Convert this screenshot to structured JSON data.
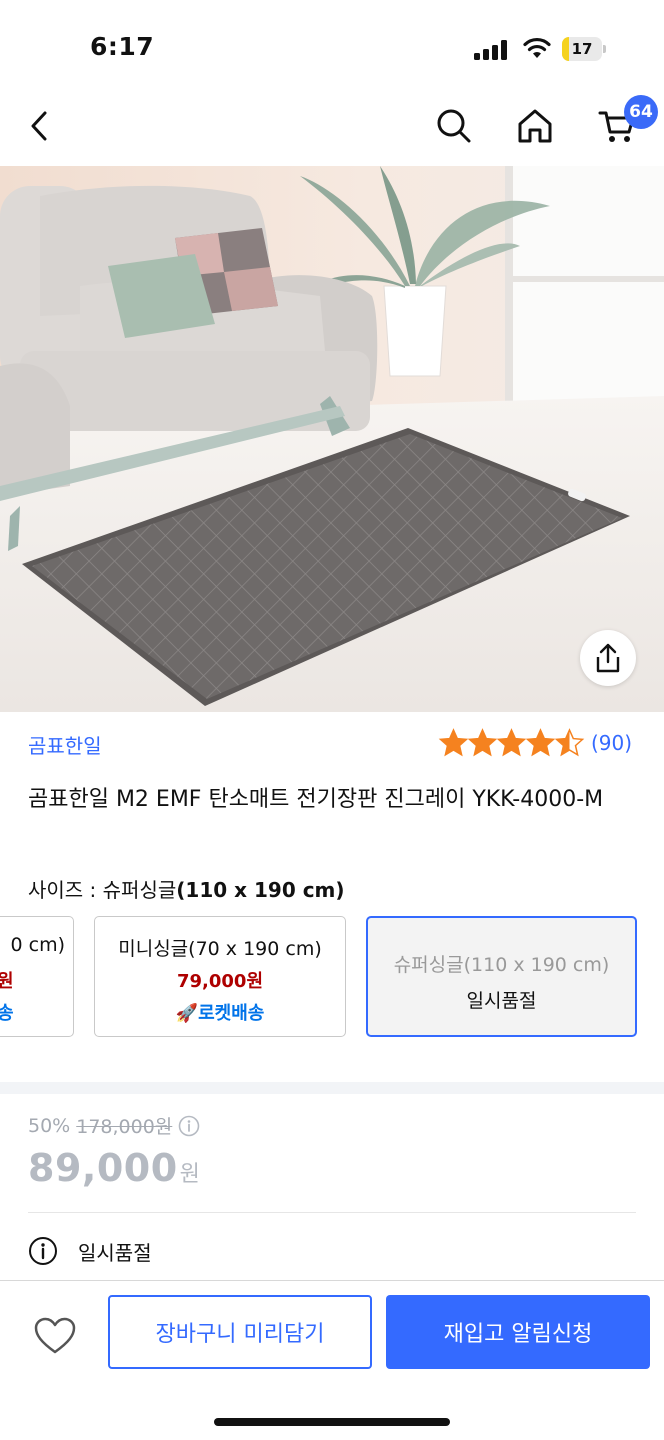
{
  "status_bar": {
    "time": "6:17",
    "battery_level": "17",
    "battery_fraction": 0.17,
    "battery_color": "#f5d21e"
  },
  "nav": {
    "back_icon": "chevron-left-icon",
    "search_icon": "search-icon",
    "home_icon": "home-icon",
    "cart_icon": "cart-icon",
    "cart_count": "64"
  },
  "product": {
    "image_alt": "living room heated mat",
    "brand": "곰표한일",
    "rating": 4.5,
    "review_count": "(90)",
    "title": "곰표한일 M2 EMF 탄소매트 전기장판 진그레이 YKK-4000-M"
  },
  "options": {
    "label_prefix": "사이즈 : 슈퍼싱글",
    "label_selected": "(110 x 190 cm)",
    "cards": [
      {
        "name": "0 cm)",
        "price": "원",
        "shipping": "송"
      },
      {
        "name": "미니싱글(70 x 190 cm)",
        "price": "79,000원",
        "shipping": "🚀로켓배송"
      },
      {
        "name": "슈퍼싱글(110 x 190 cm)",
        "status": "일시품절"
      }
    ]
  },
  "pricing": {
    "discount_rate": "50%",
    "original_price": "178,000원",
    "final_price": "89,000",
    "currency": "원",
    "availability": "일시품절"
  },
  "bottom_bar": {
    "wish_icon": "heart-icon",
    "cart_button": "장바구니 미리담기",
    "restock_button": "재입고 알림신청"
  },
  "colors": {
    "accent": "#346aff",
    "price_red": "#ae0000",
    "rocket_blue": "#0073e9",
    "star": "#f5821f"
  }
}
